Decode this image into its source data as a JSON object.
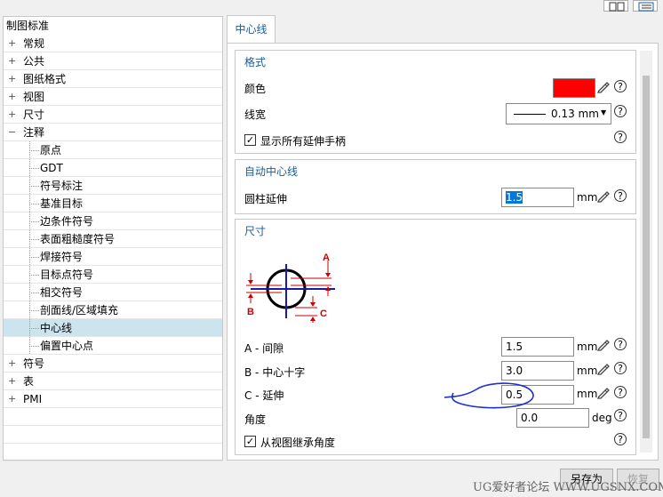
{
  "tree": {
    "root": "制图标准",
    "items": [
      {
        "label": "常规",
        "level": 0,
        "expander": "+"
      },
      {
        "label": "公共",
        "level": 0,
        "expander": "+"
      },
      {
        "label": "图纸格式",
        "level": 0,
        "expander": "+"
      },
      {
        "label": "视图",
        "level": 0,
        "expander": "+"
      },
      {
        "label": "尺寸",
        "level": 0,
        "expander": "+"
      },
      {
        "label": "注释",
        "level": 0,
        "expander": "−"
      },
      {
        "label": "原点",
        "level": 1
      },
      {
        "label": "GDT",
        "level": 1
      },
      {
        "label": "符号标注",
        "level": 1
      },
      {
        "label": "基准目标",
        "level": 1
      },
      {
        "label": "边条件符号",
        "level": 1
      },
      {
        "label": "表面粗糙度符号",
        "level": 1
      },
      {
        "label": "焊接符号",
        "level": 1
      },
      {
        "label": "目标点符号",
        "level": 1
      },
      {
        "label": "相交符号",
        "level": 1
      },
      {
        "label": "剖面线/区域填充",
        "level": 1
      },
      {
        "label": "中心线",
        "level": 1,
        "selected": true
      },
      {
        "label": "偏置中心点",
        "level": 1
      },
      {
        "label": "符号",
        "level": 0,
        "expander": "+"
      },
      {
        "label": "表",
        "level": 0,
        "expander": "+"
      },
      {
        "label": "PMI",
        "level": 0,
        "expander": "+"
      }
    ]
  },
  "tab": {
    "label": "中心线"
  },
  "format": {
    "title": "格式",
    "color_label": "颜色",
    "color_value": "#ff0000",
    "linewidth_label": "线宽",
    "linewidth_value": "0.13 mm",
    "show_all_handles_label": "显示所有延伸手柄",
    "show_all_handles_checked": true
  },
  "auto": {
    "title": "自动中心线",
    "cyl_ext_label": "圆柱延伸",
    "cyl_ext_value": "1.5",
    "unit": "mm"
  },
  "size": {
    "title": "尺寸",
    "diagram": {
      "A": "A",
      "B": "B",
      "C": "C"
    },
    "a_label": "A - 间隙",
    "a_value": "1.5",
    "b_label": "B - 中心十字",
    "b_value": "3.0",
    "c_label": "C - 延伸",
    "c_value": "0.5",
    "angle_label": "角度",
    "angle_value": "0.0",
    "angle_unit": "deg",
    "unit": "mm",
    "inherit_label": "从视图继承角度",
    "inherit_checked": true
  },
  "buttons": {
    "save_as": "另存为",
    "restore": "恢复"
  },
  "watermark": "UG爱好者论坛  WWW.UGSNX.COM",
  "icons": {
    "help": "?",
    "check": "✓",
    "dropdown": "▼"
  }
}
